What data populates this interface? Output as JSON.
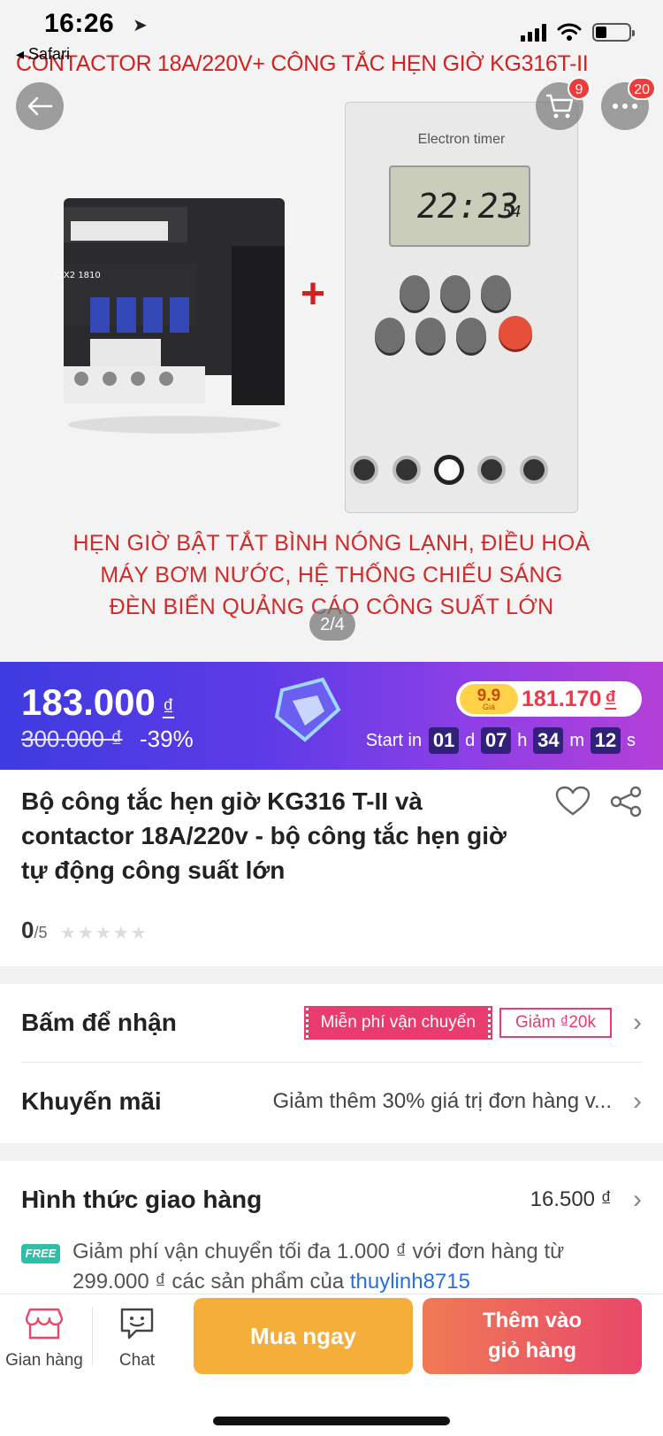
{
  "status_bar": {
    "time": "16:26",
    "back_app": "◂ Safari"
  },
  "hero": {
    "title": "CONTACTOR 18A/220V+ CÔNG TẮC HẸN GIỜ KG316T-II",
    "timer_brand": "Electron timer",
    "timer_lcd": "22:23",
    "timer_lcd_sec": "54",
    "contactor_model": "CJX2 1810",
    "caption_lines": [
      "HẸN GIỜ BẬT TẮT BÌNH NÓNG LẠNH, ĐIỀU HOÀ",
      "MÁY BƠM NƯỚC, HỆ THỐNG CHIẾU SÁNG",
      "ĐÈN BIỂN QUẢNG CÁO CÔNG SUẤT LỚN"
    ],
    "pager": "2/4",
    "cart_count": "9",
    "more_count": "20"
  },
  "flash_sale": {
    "price": "183.000",
    "currency": "₫",
    "old_price": "300.000 ₫",
    "discount": "-39%",
    "deal_tag": "9.9",
    "deal_tag_sub": "Giá",
    "deal_price": "181.170",
    "countdown_label": "Start in",
    "countdown": {
      "days": "01",
      "d": "d",
      "hours": "07",
      "h": "h",
      "minutes": "34",
      "m": "m",
      "seconds": "12",
      "s": "s"
    }
  },
  "product": {
    "title": "Bộ công tắc hẹn giờ KG316 T-II và contactor 18A/220v - bộ công tắc hẹn giờ tự động công suất lớn",
    "rating": "0",
    "rating_max": "/5"
  },
  "promo": {
    "claim_label": "Bấm để nhận",
    "free_ship_tag": "Miễn phí vận chuyển",
    "voucher_tag": "Giảm ₫20k",
    "promotion_label": "Khuyến mãi",
    "promotion_text": "Giảm thêm 30% giá trị đơn hàng v..."
  },
  "shipping": {
    "label": "Hình thức giao hàng",
    "price": "16.500 ₫",
    "free_badge": "FREE",
    "note": "Giảm phí vận chuyển tối đa 1.000 ₫ với đơn hàng từ 299.000 ₫ các sản phẩm của ",
    "shop_link": "thuylinh8715"
  },
  "bottom_bar": {
    "store_label": "Gian hàng",
    "chat_label": "Chat",
    "buy_now": "Mua ngay",
    "add_to_cart_line1": "Thêm vào",
    "add_to_cart_line2": "giỏ hàng"
  },
  "colors": {
    "flash_gradient_start": "#3e3be0",
    "flash_gradient_end": "#b43fd8",
    "buy_now": "#f5ae3a",
    "add_to_cart": "#e8476a",
    "promo_pink": "#e83c6e"
  }
}
